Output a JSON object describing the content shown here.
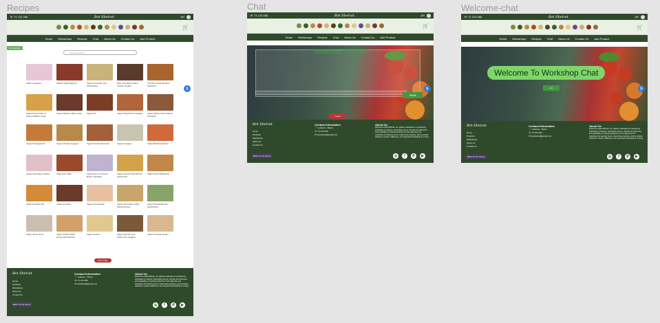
{
  "frames": {
    "recipes": {
      "label": "Recipes"
    },
    "chat": {
      "label": "Chat"
    },
    "welcome": {
      "label": "Welcome-chat"
    }
  },
  "topbar": {
    "phone": "71 123 456",
    "lang": "AR"
  },
  "nav": [
    "Home",
    "Workshops",
    "Recipes",
    "Chat",
    "About Us",
    "Contact Us",
    "Add Product"
  ],
  "recipes": {
    "badge": "Our Recipes",
    "search_placeholder": "Search Recipes",
    "items": [
      "Vegan cupcakes",
      "Spiked Vegan Eggnog",
      "Vegan Cucumber Tea Sandwiches",
      "Best Chocolate Peanut Cluster (Vegan)",
      "The Best Vegan Reuben Sandwich",
      "Vegan Pound Cake & Peanut Muffins recipe",
      "Vegan Nanaimo Bars recipe",
      "Vegan Pie",
      "Vegan Shepherd's Lasagna",
      "Vegan Whole Grain Cheese Sandwich",
      "Vegan Pineapple Pie",
      "Vegan Chicken Nuggets",
      "Vegan Candied Almonds",
      "Vegan Lasagna",
      "Vegan Buffalo Roasted",
      "Vegan Chocolate Cookies",
      "Vegan Pot Cake",
      "Vegan Lemon & Pecan Butter Cupcakes",
      "Vegan Caramel Shortbread Shortbread",
      "Vegan pizza Margherita",
      "Vegan Pumpkin Pie",
      "Vegan brownies",
      "Vegan Cheesecake",
      "Vegan Chocolate Coffee Walnut Recipe",
      "Vegan Mozzarella Tea Sandwiches",
      "Vegan whole pizza",
      "Vegan Grilled Peach Homemade Sherbet",
      "Vegan Scones",
      "Vegan Spinach and Mushroom Lasagna",
      "Vegan Pancake Dream"
    ],
    "pager": "More Page"
  },
  "chat": {
    "title": "Workshop: ROOM2",
    "send": "Send",
    "leave": "Leave"
  },
  "welcome": {
    "title": "Welcome To Workshop Chat",
    "join": "Join"
  },
  "footer": {
    "logo": "Bet Sbeirat",
    "links": [
      "Home",
      "Products",
      "Workshops",
      "About Us",
      "Contact Us"
    ],
    "contact_title": "Contact Information",
    "contact": [
      "Lebanon - Beirut",
      "71 123 456",
      "betsbeirat@gmail.com"
    ],
    "about_title": "About Us",
    "about_text": "Welcome to Beit Mkhtrah, our platform dedicated to empowering individuals in Lebanon, particularly women, through the dimension and availability of ressinful products for their daily lives.Our workshops for learning how to make these products, and an activist initiative to create a difference, we empowered individuals in a living.",
    "back_to_top": "Back To Our Home",
    "socials": [
      "instagram",
      "facebook",
      "whatsapp",
      "youtube"
    ]
  }
}
